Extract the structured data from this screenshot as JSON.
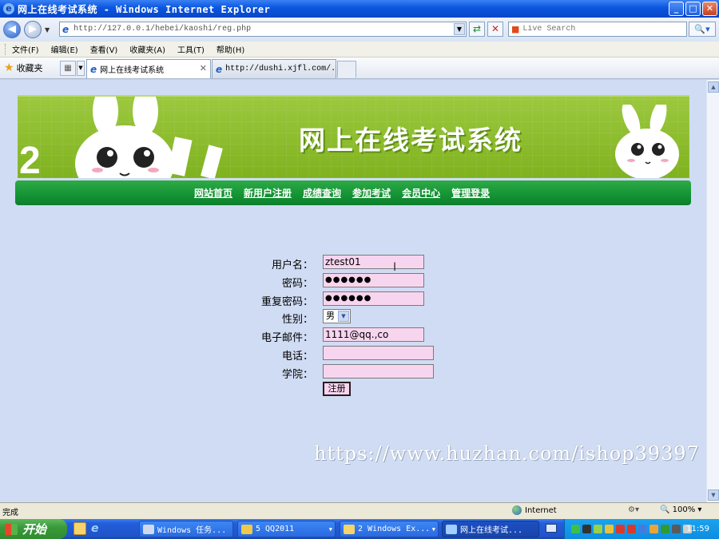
{
  "window": {
    "title": "网上在线考试系统 - Windows Internet Explorer",
    "min": "_",
    "max": "□",
    "close": "✕"
  },
  "address": {
    "url": "http://127.0.0.1/hebei/kaoshi/reg.php",
    "search_placeholder": "Live Search"
  },
  "menu": [
    "文件(F)",
    "编辑(E)",
    "查看(V)",
    "收藏夹(A)",
    "工具(T)",
    "帮助(H)"
  ],
  "favorites": {
    "label": "收藏夹"
  },
  "tabs": [
    {
      "label": "网上在线考试系统"
    },
    {
      "label": "http://dushi.xjfl.com/..."
    }
  ],
  "site": {
    "banner_title": "网上在线考试系统",
    "nav": [
      "网站首页",
      "新用户注册",
      "成绩查询",
      "参加考试",
      "会员中心",
      "管理登录"
    ]
  },
  "form": {
    "username_label": "用户名：",
    "username_value": "ztest01",
    "password_label": "密码：",
    "password_value": "●●●●●●",
    "confirm_label": "重复密码：",
    "confirm_value": "●●●●●●",
    "gender_label": "性别：",
    "gender_value": "男",
    "email_label": "电子邮件：",
    "email_value": "1111@qq.,co",
    "phone_label": "电话：",
    "phone_value": "",
    "college_label": "学院：",
    "college_value": "",
    "submit_label": "注册"
  },
  "watermark": "https://www.huzhan.com/ishop39397",
  "status": {
    "text": "完成",
    "zone": "Internet",
    "zoom": "100%"
  },
  "taskbar": {
    "start": "开始",
    "items": [
      {
        "label": "Windows 任务..."
      },
      {
        "label": "5 QQ2011"
      },
      {
        "label": "2 Windows Ex..."
      },
      {
        "label": "网上在线考试..."
      }
    ],
    "clock": "11:59"
  }
}
